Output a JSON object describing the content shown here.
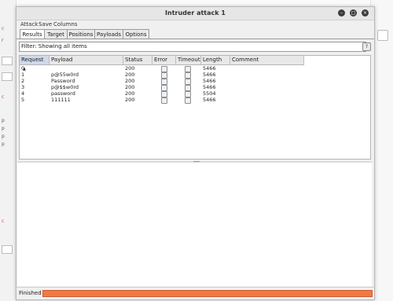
{
  "window": {
    "title": "Intruder attack 1"
  },
  "menu": [
    "Attack",
    "Save",
    "Columns"
  ],
  "tabs": [
    "Results",
    "Target",
    "Positions",
    "Payloads",
    "Options"
  ],
  "active_tab": "Results",
  "filter": {
    "text": "Filter: Showing all items",
    "help_label": "?"
  },
  "table": {
    "columns": [
      "Request",
      "Payload",
      "Status",
      "Error",
      "Timeout",
      "Length",
      "Comment"
    ],
    "sort_column": "Request",
    "sort_direction": "ascending",
    "rows": [
      {
        "request": "0",
        "payload": "",
        "status": "200",
        "error": false,
        "timeout": false,
        "length": "5466",
        "comment": ""
      },
      {
        "request": "1",
        "payload": "p@55w0rd",
        "status": "200",
        "error": false,
        "timeout": false,
        "length": "5466",
        "comment": ""
      },
      {
        "request": "2",
        "payload": "Password",
        "status": "200",
        "error": false,
        "timeout": false,
        "length": "5466",
        "comment": ""
      },
      {
        "request": "3",
        "payload": "p@$$w0rd",
        "status": "200",
        "error": false,
        "timeout": false,
        "length": "5466",
        "comment": ""
      },
      {
        "request": "4",
        "payload": "password",
        "status": "200",
        "error": false,
        "timeout": false,
        "length": "5504",
        "comment": ""
      },
      {
        "request": "5",
        "payload": "111111",
        "status": "200",
        "error": false,
        "timeout": false,
        "length": "5466",
        "comment": ""
      }
    ]
  },
  "status": {
    "text": "Finished",
    "progress": 1.0
  },
  "colors": {
    "accent": "#f07a45",
    "accent_border": "#cf5a2a",
    "background_mark": "#d0531c"
  },
  "icons": {
    "minimize": "minimize-icon",
    "maximize": "maximize-icon",
    "close": "close-icon",
    "sort": "sort-asc-icon"
  }
}
